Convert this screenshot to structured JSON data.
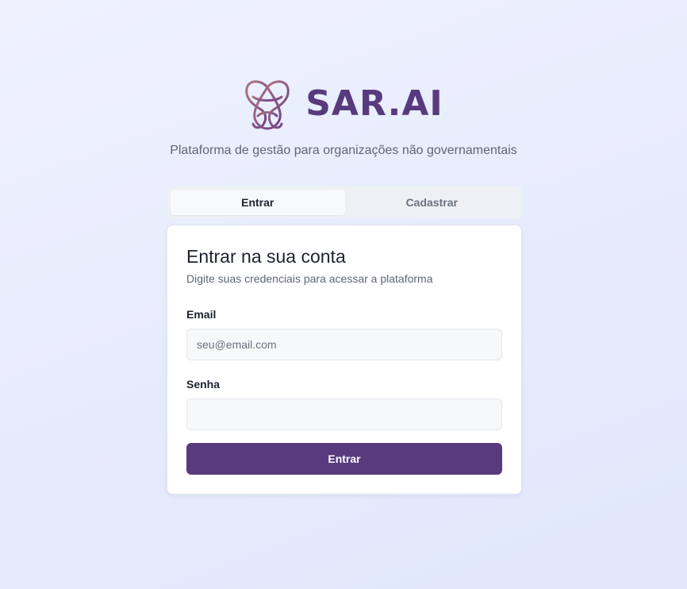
{
  "brand": {
    "name": "SAR.AI",
    "logo_icon": "interlaced-knot-logo-icon",
    "tagline": "Plataforma de gestão para organizações não governamentais",
    "colors": {
      "primary": "#573b7e",
      "logo_gradient_start": "#b07680",
      "logo_gradient_end": "#6b3f8a"
    }
  },
  "tabs": [
    {
      "label": "Entrar",
      "active": true
    },
    {
      "label": "Cadastrar",
      "active": false
    }
  ],
  "login_form": {
    "title": "Entrar na sua conta",
    "subtitle": "Digite suas credenciais para acessar a plataforma",
    "email": {
      "label": "Email",
      "placeholder": "seu@email.com",
      "value": ""
    },
    "password": {
      "label": "Senha",
      "placeholder": "",
      "value": ""
    },
    "submit_label": "Entrar"
  }
}
